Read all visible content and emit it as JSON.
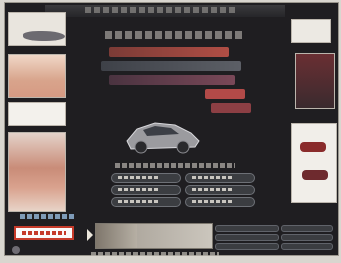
{
  "window": {
    "title": "",
    "footer_text": ""
  },
  "garage": {
    "category_buttons": [
      {
        "label": ""
      },
      {
        "label": ""
      },
      {
        "label": ""
      },
      {
        "label": ""
      },
      {
        "label": ""
      }
    ],
    "stats": [
      {
        "label": ""
      },
      {
        "label": ""
      },
      {
        "label": ""
      },
      {
        "label": ""
      },
      {
        "label": ""
      },
      {
        "label": ""
      }
    ],
    "progress": 0.35
  },
  "colors": {
    "accent_red": "#c53a2a",
    "background": "#1f1e21",
    "panel": "#ece9e3"
  },
  "icons": [
    "car-icon",
    "settings-icon"
  ]
}
